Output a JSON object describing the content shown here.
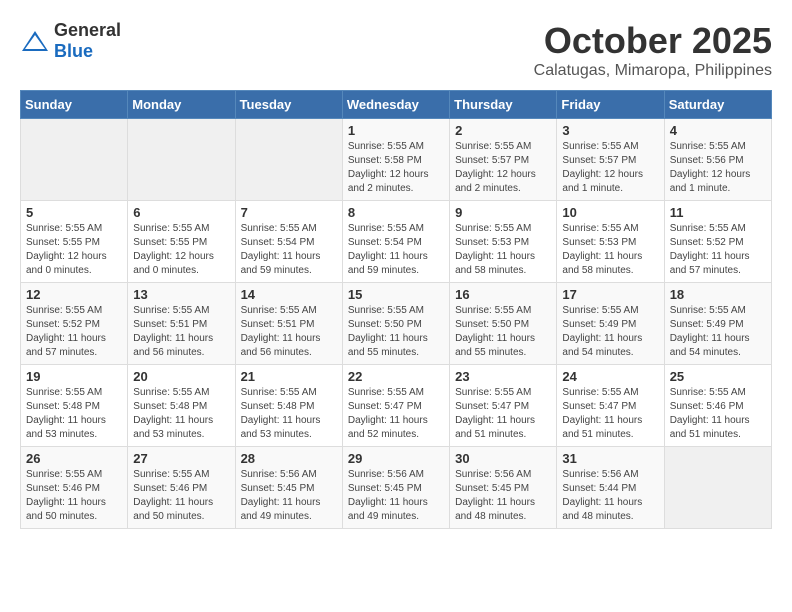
{
  "logo": {
    "general": "General",
    "blue": "Blue"
  },
  "header": {
    "title": "October 2025",
    "subtitle": "Calatugas, Mimaropa, Philippines"
  },
  "weekdays": [
    "Sunday",
    "Monday",
    "Tuesday",
    "Wednesday",
    "Thursday",
    "Friday",
    "Saturday"
  ],
  "weeks": [
    [
      {
        "day": "",
        "info": ""
      },
      {
        "day": "",
        "info": ""
      },
      {
        "day": "",
        "info": ""
      },
      {
        "day": "1",
        "info": "Sunrise: 5:55 AM\nSunset: 5:58 PM\nDaylight: 12 hours\nand 2 minutes."
      },
      {
        "day": "2",
        "info": "Sunrise: 5:55 AM\nSunset: 5:57 PM\nDaylight: 12 hours\nand 2 minutes."
      },
      {
        "day": "3",
        "info": "Sunrise: 5:55 AM\nSunset: 5:57 PM\nDaylight: 12 hours\nand 1 minute."
      },
      {
        "day": "4",
        "info": "Sunrise: 5:55 AM\nSunset: 5:56 PM\nDaylight: 12 hours\nand 1 minute."
      }
    ],
    [
      {
        "day": "5",
        "info": "Sunrise: 5:55 AM\nSunset: 5:55 PM\nDaylight: 12 hours\nand 0 minutes."
      },
      {
        "day": "6",
        "info": "Sunrise: 5:55 AM\nSunset: 5:55 PM\nDaylight: 12 hours\nand 0 minutes."
      },
      {
        "day": "7",
        "info": "Sunrise: 5:55 AM\nSunset: 5:54 PM\nDaylight: 11 hours\nand 59 minutes."
      },
      {
        "day": "8",
        "info": "Sunrise: 5:55 AM\nSunset: 5:54 PM\nDaylight: 11 hours\nand 59 minutes."
      },
      {
        "day": "9",
        "info": "Sunrise: 5:55 AM\nSunset: 5:53 PM\nDaylight: 11 hours\nand 58 minutes."
      },
      {
        "day": "10",
        "info": "Sunrise: 5:55 AM\nSunset: 5:53 PM\nDaylight: 11 hours\nand 58 minutes."
      },
      {
        "day": "11",
        "info": "Sunrise: 5:55 AM\nSunset: 5:52 PM\nDaylight: 11 hours\nand 57 minutes."
      }
    ],
    [
      {
        "day": "12",
        "info": "Sunrise: 5:55 AM\nSunset: 5:52 PM\nDaylight: 11 hours\nand 57 minutes."
      },
      {
        "day": "13",
        "info": "Sunrise: 5:55 AM\nSunset: 5:51 PM\nDaylight: 11 hours\nand 56 minutes."
      },
      {
        "day": "14",
        "info": "Sunrise: 5:55 AM\nSunset: 5:51 PM\nDaylight: 11 hours\nand 56 minutes."
      },
      {
        "day": "15",
        "info": "Sunrise: 5:55 AM\nSunset: 5:50 PM\nDaylight: 11 hours\nand 55 minutes."
      },
      {
        "day": "16",
        "info": "Sunrise: 5:55 AM\nSunset: 5:50 PM\nDaylight: 11 hours\nand 55 minutes."
      },
      {
        "day": "17",
        "info": "Sunrise: 5:55 AM\nSunset: 5:49 PM\nDaylight: 11 hours\nand 54 minutes."
      },
      {
        "day": "18",
        "info": "Sunrise: 5:55 AM\nSunset: 5:49 PM\nDaylight: 11 hours\nand 54 minutes."
      }
    ],
    [
      {
        "day": "19",
        "info": "Sunrise: 5:55 AM\nSunset: 5:48 PM\nDaylight: 11 hours\nand 53 minutes."
      },
      {
        "day": "20",
        "info": "Sunrise: 5:55 AM\nSunset: 5:48 PM\nDaylight: 11 hours\nand 53 minutes."
      },
      {
        "day": "21",
        "info": "Sunrise: 5:55 AM\nSunset: 5:48 PM\nDaylight: 11 hours\nand 53 minutes."
      },
      {
        "day": "22",
        "info": "Sunrise: 5:55 AM\nSunset: 5:47 PM\nDaylight: 11 hours\nand 52 minutes."
      },
      {
        "day": "23",
        "info": "Sunrise: 5:55 AM\nSunset: 5:47 PM\nDaylight: 11 hours\nand 51 minutes."
      },
      {
        "day": "24",
        "info": "Sunrise: 5:55 AM\nSunset: 5:47 PM\nDaylight: 11 hours\nand 51 minutes."
      },
      {
        "day": "25",
        "info": "Sunrise: 5:55 AM\nSunset: 5:46 PM\nDaylight: 11 hours\nand 51 minutes."
      }
    ],
    [
      {
        "day": "26",
        "info": "Sunrise: 5:55 AM\nSunset: 5:46 PM\nDaylight: 11 hours\nand 50 minutes."
      },
      {
        "day": "27",
        "info": "Sunrise: 5:55 AM\nSunset: 5:46 PM\nDaylight: 11 hours\nand 50 minutes."
      },
      {
        "day": "28",
        "info": "Sunrise: 5:56 AM\nSunset: 5:45 PM\nDaylight: 11 hours\nand 49 minutes."
      },
      {
        "day": "29",
        "info": "Sunrise: 5:56 AM\nSunset: 5:45 PM\nDaylight: 11 hours\nand 49 minutes."
      },
      {
        "day": "30",
        "info": "Sunrise: 5:56 AM\nSunset: 5:45 PM\nDaylight: 11 hours\nand 48 minutes."
      },
      {
        "day": "31",
        "info": "Sunrise: 5:56 AM\nSunset: 5:44 PM\nDaylight: 11 hours\nand 48 minutes."
      },
      {
        "day": "",
        "info": ""
      }
    ]
  ]
}
